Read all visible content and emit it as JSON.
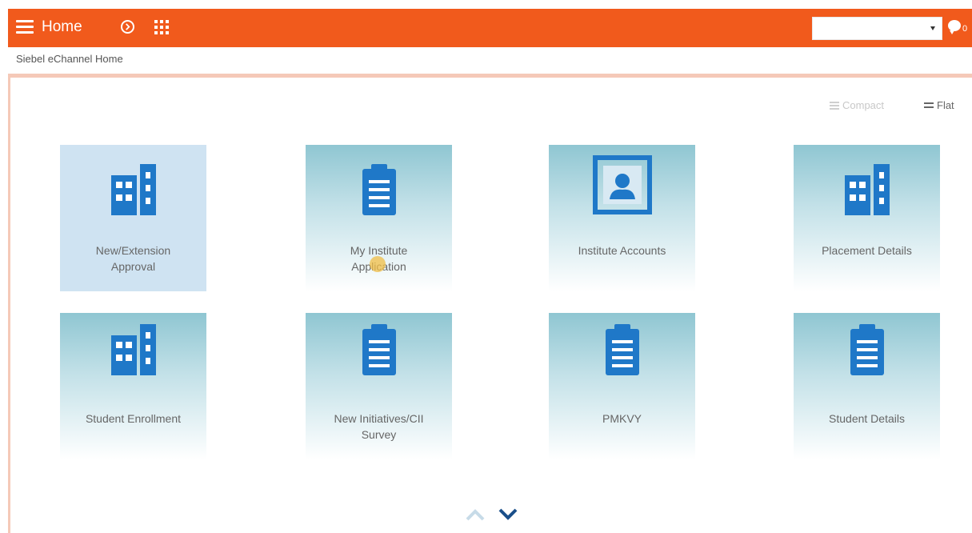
{
  "topbar": {
    "title": "Home",
    "notification_count": "0",
    "select_value": "",
    "bar_color": "#f15a1c"
  },
  "breadcrumb": "Siebel eChannel Home",
  "view_toggle": {
    "compact_label": "Compact",
    "flat_label": "Flat"
  },
  "tiles": [
    {
      "label": "New/Extension\nApproval",
      "icon": "building-icon",
      "selected": true
    },
    {
      "label": "My Institute\nApplication",
      "icon": "clipboard-icon"
    },
    {
      "label": "Institute Accounts",
      "icon": "contact-card-icon"
    },
    {
      "label": "Placement Details",
      "icon": "building-icon"
    },
    {
      "label": "Student Enrollment",
      "icon": "building-icon"
    },
    {
      "label": "New Initiatives/CII\nSurvey",
      "icon": "clipboard-icon"
    },
    {
      "label": "PMKVY",
      "icon": "clipboard-icon"
    },
    {
      "label": "Student Details",
      "icon": "clipboard-icon"
    }
  ],
  "colors": {
    "accent": "#f15a1c",
    "icon_blue": "#1f78c8",
    "tile_top": "#8fc6d2"
  }
}
